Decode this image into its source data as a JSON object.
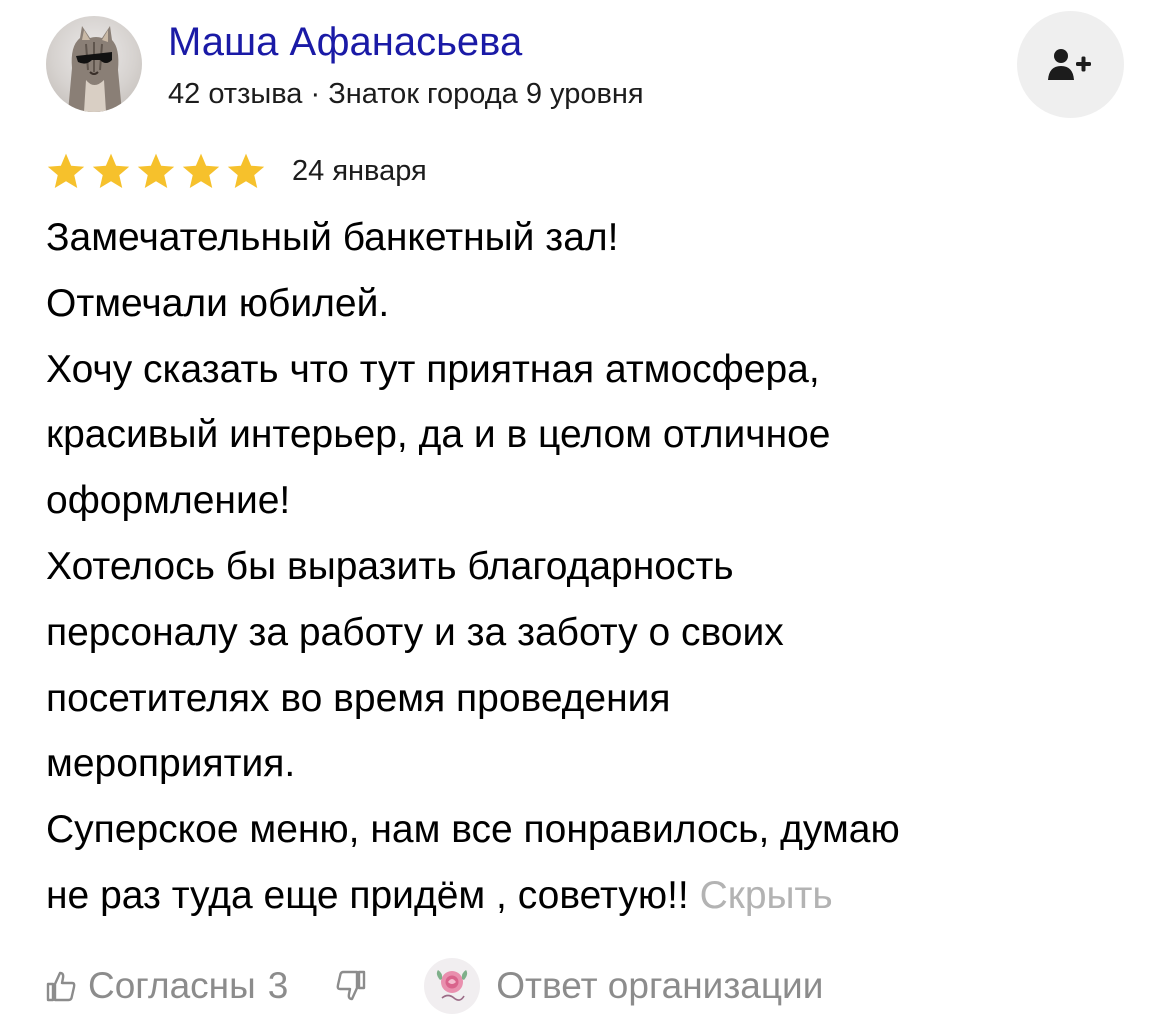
{
  "author": {
    "name": "Маша Афанасьева",
    "meta": "42 отзыва · Знаток города 9 уровня",
    "avatar_icon": "cat-avatar"
  },
  "follow_button": {
    "icon": "add-user-icon"
  },
  "review": {
    "rating": 5,
    "rating_max": 5,
    "star_color": "#f6c12c",
    "date": "24 января",
    "lines": [
      "Замечательный банкетный зал!",
      "Отмечали юбилей.",
      "Хочу сказать что тут приятная атмосфера,",
      "красивый интерьер, да и в целом отличное",
      "оформление!",
      "Хотелось бы выразить благодарность",
      "персоналу за работу и за заботу о своих",
      "посетителях во время проведения",
      "мероприятия.",
      "Суперское меню, нам все понравилось, думаю",
      "не раз туда еще придём , советую!!"
    ],
    "hide_label": "Скрыть"
  },
  "footer": {
    "like_label": "Согласны",
    "like_count": "3",
    "org_reply_label": "Ответ организации",
    "org_logo_icon": "rose-logo"
  },
  "colors": {
    "name": "#1a1aa6",
    "text": "#000000",
    "muted": "#8c8c8c",
    "hide_link": "#b3b3b3",
    "button_bg": "#efefef"
  }
}
